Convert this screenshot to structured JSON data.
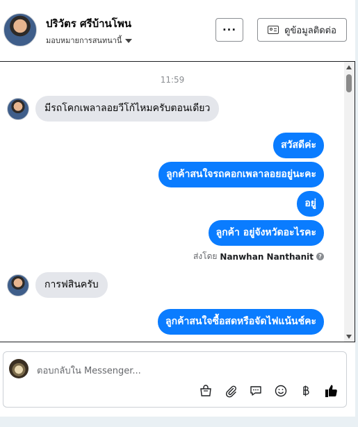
{
  "header": {
    "contact_name": "ปริวัตร ศรีบ้านโพน",
    "assign_label": "มอบหมายการสนทนานี้",
    "more_label": "···",
    "contact_button_label": "ดูข้อมูลติดต่อ"
  },
  "conversation": {
    "timestamp": "11:59",
    "messages": [
      {
        "direction": "in",
        "text": "มีรถโคกเพลาลอยวีโก้ไหมครับตอนเดียว"
      },
      {
        "direction": "out",
        "text": "สวัสดีค่ะ"
      },
      {
        "direction": "out",
        "text": "ลูกค้าสนใจรถคอกเพลาลอยอยู่นะคะ"
      },
      {
        "direction": "out",
        "text": "อยู่"
      },
      {
        "direction": "out",
        "text": "ลูกค้า อยู่จังหวัดอะไรคะ"
      },
      {
        "direction": "in",
        "text": "การฟสินครับ"
      },
      {
        "direction": "out",
        "text": "ลูกค้าสนใจซื้อสดหรือจัดไฟแน้นช์คะ"
      }
    ],
    "sent_by_prefix": "ส่งโดย",
    "sent_by_name": "Nanwhan Nanthanit",
    "help_glyph": "?"
  },
  "composer": {
    "placeholder": "ตอบกลับใน Messenger...",
    "tools": [
      "shopping-bag-icon",
      "paperclip-icon",
      "saved-reply-icon",
      "emoji-icon",
      "baht-icon",
      "like-icon"
    ]
  },
  "colors": {
    "outgoing_bubble": "#0a7cff",
    "incoming_bubble": "#e4e6eb",
    "like": "#050505"
  }
}
